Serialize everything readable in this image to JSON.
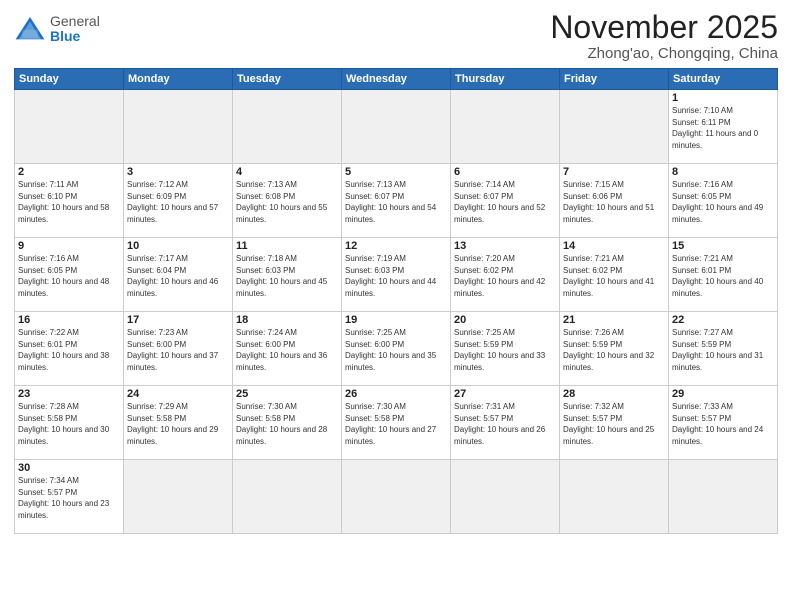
{
  "header": {
    "logo_general": "General",
    "logo_blue": "Blue",
    "month": "November 2025",
    "location": "Zhong'ao, Chongqing, China"
  },
  "weekdays": [
    "Sunday",
    "Monday",
    "Tuesday",
    "Wednesday",
    "Thursday",
    "Friday",
    "Saturday"
  ],
  "weeks": [
    [
      {
        "day": "",
        "info": ""
      },
      {
        "day": "",
        "info": ""
      },
      {
        "day": "",
        "info": ""
      },
      {
        "day": "",
        "info": ""
      },
      {
        "day": "",
        "info": ""
      },
      {
        "day": "",
        "info": ""
      },
      {
        "day": "1",
        "info": "Sunrise: 7:10 AM\nSunset: 6:11 PM\nDaylight: 11 hours and 0 minutes."
      }
    ],
    [
      {
        "day": "2",
        "info": "Sunrise: 7:11 AM\nSunset: 6:10 PM\nDaylight: 10 hours and 58 minutes."
      },
      {
        "day": "3",
        "info": "Sunrise: 7:12 AM\nSunset: 6:09 PM\nDaylight: 10 hours and 57 minutes."
      },
      {
        "day": "4",
        "info": "Sunrise: 7:13 AM\nSunset: 6:08 PM\nDaylight: 10 hours and 55 minutes."
      },
      {
        "day": "5",
        "info": "Sunrise: 7:13 AM\nSunset: 6:07 PM\nDaylight: 10 hours and 54 minutes."
      },
      {
        "day": "6",
        "info": "Sunrise: 7:14 AM\nSunset: 6:07 PM\nDaylight: 10 hours and 52 minutes."
      },
      {
        "day": "7",
        "info": "Sunrise: 7:15 AM\nSunset: 6:06 PM\nDaylight: 10 hours and 51 minutes."
      },
      {
        "day": "8",
        "info": "Sunrise: 7:16 AM\nSunset: 6:05 PM\nDaylight: 10 hours and 49 minutes."
      }
    ],
    [
      {
        "day": "9",
        "info": "Sunrise: 7:16 AM\nSunset: 6:05 PM\nDaylight: 10 hours and 48 minutes."
      },
      {
        "day": "10",
        "info": "Sunrise: 7:17 AM\nSunset: 6:04 PM\nDaylight: 10 hours and 46 minutes."
      },
      {
        "day": "11",
        "info": "Sunrise: 7:18 AM\nSunset: 6:03 PM\nDaylight: 10 hours and 45 minutes."
      },
      {
        "day": "12",
        "info": "Sunrise: 7:19 AM\nSunset: 6:03 PM\nDaylight: 10 hours and 44 minutes."
      },
      {
        "day": "13",
        "info": "Sunrise: 7:20 AM\nSunset: 6:02 PM\nDaylight: 10 hours and 42 minutes."
      },
      {
        "day": "14",
        "info": "Sunrise: 7:21 AM\nSunset: 6:02 PM\nDaylight: 10 hours and 41 minutes."
      },
      {
        "day": "15",
        "info": "Sunrise: 7:21 AM\nSunset: 6:01 PM\nDaylight: 10 hours and 40 minutes."
      }
    ],
    [
      {
        "day": "16",
        "info": "Sunrise: 7:22 AM\nSunset: 6:01 PM\nDaylight: 10 hours and 38 minutes."
      },
      {
        "day": "17",
        "info": "Sunrise: 7:23 AM\nSunset: 6:00 PM\nDaylight: 10 hours and 37 minutes."
      },
      {
        "day": "18",
        "info": "Sunrise: 7:24 AM\nSunset: 6:00 PM\nDaylight: 10 hours and 36 minutes."
      },
      {
        "day": "19",
        "info": "Sunrise: 7:25 AM\nSunset: 6:00 PM\nDaylight: 10 hours and 35 minutes."
      },
      {
        "day": "20",
        "info": "Sunrise: 7:25 AM\nSunset: 5:59 PM\nDaylight: 10 hours and 33 minutes."
      },
      {
        "day": "21",
        "info": "Sunrise: 7:26 AM\nSunset: 5:59 PM\nDaylight: 10 hours and 32 minutes."
      },
      {
        "day": "22",
        "info": "Sunrise: 7:27 AM\nSunset: 5:59 PM\nDaylight: 10 hours and 31 minutes."
      }
    ],
    [
      {
        "day": "23",
        "info": "Sunrise: 7:28 AM\nSunset: 5:58 PM\nDaylight: 10 hours and 30 minutes."
      },
      {
        "day": "24",
        "info": "Sunrise: 7:29 AM\nSunset: 5:58 PM\nDaylight: 10 hours and 29 minutes."
      },
      {
        "day": "25",
        "info": "Sunrise: 7:30 AM\nSunset: 5:58 PM\nDaylight: 10 hours and 28 minutes."
      },
      {
        "day": "26",
        "info": "Sunrise: 7:30 AM\nSunset: 5:58 PM\nDaylight: 10 hours and 27 minutes."
      },
      {
        "day": "27",
        "info": "Sunrise: 7:31 AM\nSunset: 5:57 PM\nDaylight: 10 hours and 26 minutes."
      },
      {
        "day": "28",
        "info": "Sunrise: 7:32 AM\nSunset: 5:57 PM\nDaylight: 10 hours and 25 minutes."
      },
      {
        "day": "29",
        "info": "Sunrise: 7:33 AM\nSunset: 5:57 PM\nDaylight: 10 hours and 24 minutes."
      }
    ],
    [
      {
        "day": "30",
        "info": "Sunrise: 7:34 AM\nSunset: 5:57 PM\nDaylight: 10 hours and 23 minutes."
      },
      {
        "day": "",
        "info": ""
      },
      {
        "day": "",
        "info": ""
      },
      {
        "day": "",
        "info": ""
      },
      {
        "day": "",
        "info": ""
      },
      {
        "day": "",
        "info": ""
      },
      {
        "day": "",
        "info": ""
      }
    ]
  ]
}
